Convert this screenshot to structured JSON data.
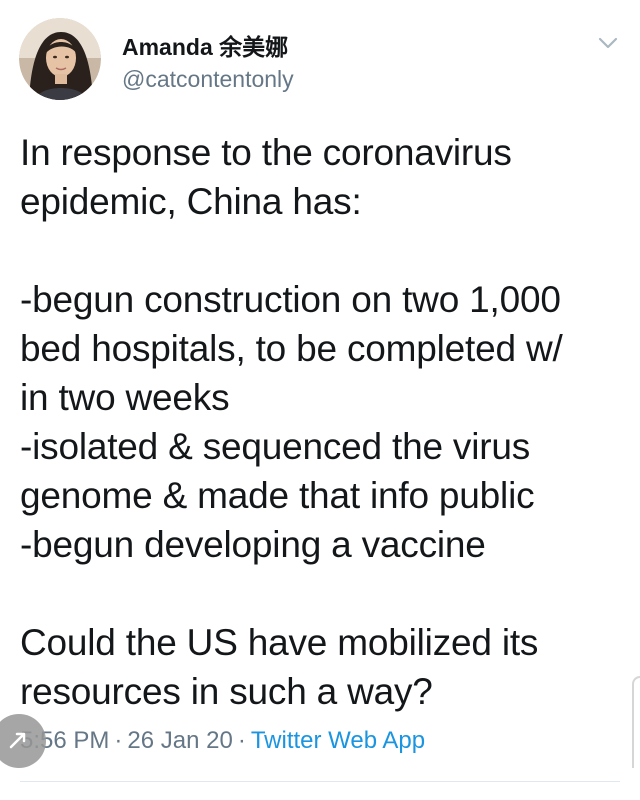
{
  "author": {
    "display_name": "Amanda 余美娜",
    "handle": "@catcontentonly",
    "avatar_icon": "profile-photo"
  },
  "tweet": {
    "lines": [
      "In response to the coronavirus",
      "epidemic, China has:",
      "",
      "-begun construction on two 1,000",
      "bed hospitals, to be completed w/",
      "in two weeks",
      "-isolated & sequenced the virus",
      "genome & made that info public",
      "-begun developing a vaccine",
      "",
      "Could the US have mobilized its",
      "resources in such a way?"
    ]
  },
  "meta": {
    "time": "5:56 PM",
    "date": "26 Jan 20",
    "source": "Twitter Web App",
    "separator": "·"
  },
  "colors": {
    "text": "#14171a",
    "secondary": "#657786",
    "link": "#1b95e0",
    "divider": "#e1e8ed"
  }
}
